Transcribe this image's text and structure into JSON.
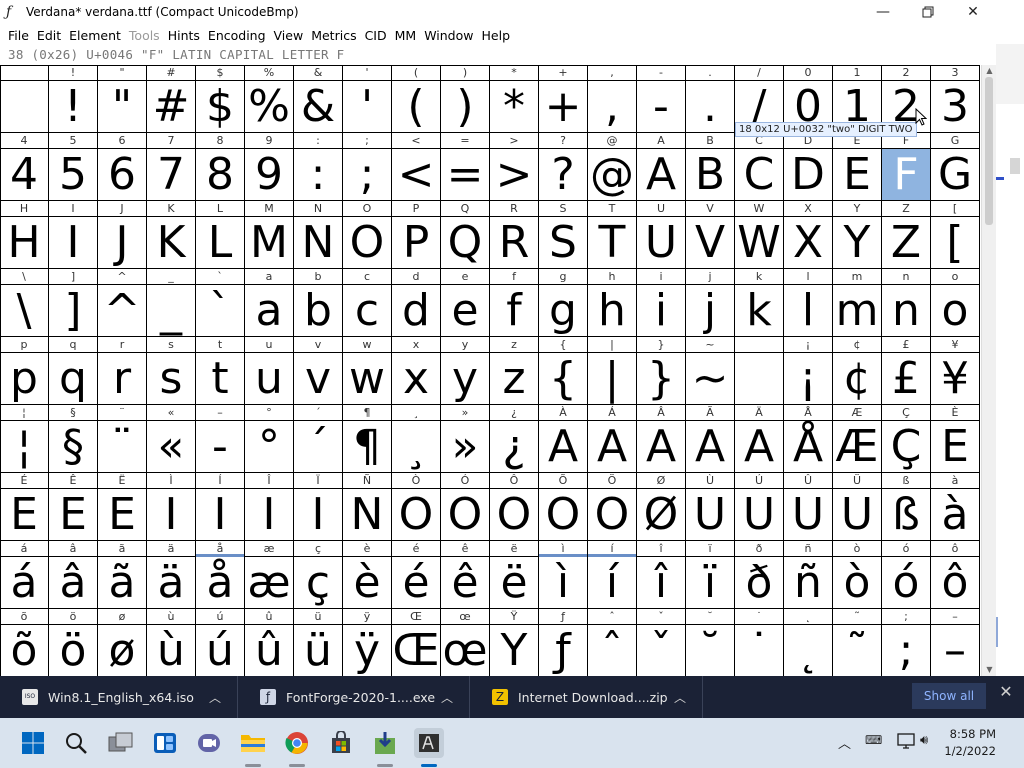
{
  "window": {
    "title": "Verdana*  verdana.ttf (Compact UnicodeBmp)",
    "minimize": "—",
    "maximize": "❐",
    "close": "✕"
  },
  "menu": [
    {
      "label": "File",
      "disabled": false
    },
    {
      "label": "Edit",
      "disabled": false
    },
    {
      "label": "Element",
      "disabled": false
    },
    {
      "label": "Tools",
      "disabled": true
    },
    {
      "label": "Hints",
      "disabled": false
    },
    {
      "label": "Encoding",
      "disabled": false
    },
    {
      "label": "View",
      "disabled": false
    },
    {
      "label": "Metrics",
      "disabled": false
    },
    {
      "label": "CID",
      "disabled": false
    },
    {
      "label": "MM",
      "disabled": false
    },
    {
      "label": "Window",
      "disabled": false
    },
    {
      "label": "Help",
      "disabled": false
    }
  ],
  "info_line": "38 (0x26) U+0046 \"F\" LATIN CAPITAL LETTER F",
  "tooltip": "18 0x12 U+0032 \"two\" DIGIT TWO",
  "selected_cell": "F",
  "grid": {
    "rows": [
      {
        "labels": [
          " ",
          "!",
          "\"",
          "#",
          "$",
          "%",
          "&",
          "'",
          "(",
          ")",
          "*",
          "+",
          ",",
          "-",
          ".",
          "/",
          "0",
          "1",
          "2",
          "3"
        ],
        "glyphs": [
          " ",
          "!",
          "\"",
          "#",
          "$",
          "%",
          "&",
          "'",
          "(",
          ")",
          "*",
          "+",
          ",",
          "-",
          ".",
          "/",
          "0",
          "1",
          "2",
          "3"
        ]
      },
      {
        "labels": [
          "4",
          "5",
          "6",
          "7",
          "8",
          "9",
          ":",
          ";",
          "<",
          "=",
          ">",
          "?",
          "@",
          "A",
          "B",
          "C",
          "D",
          "E",
          "F",
          "G"
        ],
        "glyphs": [
          "4",
          "5",
          "6",
          "7",
          "8",
          "9",
          ":",
          ";",
          "<",
          "=",
          ">",
          "?",
          "@",
          "A",
          "B",
          "C",
          "D",
          "E",
          "F",
          "G"
        ]
      },
      {
        "labels": [
          "H",
          "I",
          "J",
          "K",
          "L",
          "M",
          "N",
          "O",
          "P",
          "Q",
          "R",
          "S",
          "T",
          "U",
          "V",
          "W",
          "X",
          "Y",
          "Z",
          "["
        ],
        "glyphs": [
          "H",
          "I",
          "J",
          "K",
          "L",
          "M",
          "N",
          "O",
          "P",
          "Q",
          "R",
          "S",
          "T",
          "U",
          "V",
          "W",
          "X",
          "Y",
          "Z",
          "["
        ]
      },
      {
        "labels": [
          "\\",
          "]",
          "^",
          "_",
          "`",
          "a",
          "b",
          "c",
          "d",
          "e",
          "f",
          "g",
          "h",
          "i",
          "j",
          "k",
          "l",
          "m",
          "n",
          "o"
        ],
        "glyphs": [
          "\\",
          "]",
          "^",
          "_",
          "`",
          "a",
          "b",
          "c",
          "d",
          "e",
          "f",
          "g",
          "h",
          "i",
          "j",
          "k",
          "l",
          "m",
          "n",
          "o"
        ]
      },
      {
        "labels": [
          "p",
          "q",
          "r",
          "s",
          "t",
          "u",
          "v",
          "w",
          "x",
          "y",
          "z",
          "{",
          "|",
          "}",
          "~",
          "",
          "¡",
          "¢",
          "£",
          "¥"
        ],
        "glyphs": [
          "p",
          "q",
          "r",
          "s",
          "t",
          "u",
          "v",
          "w",
          "x",
          "y",
          "z",
          "{",
          "|",
          "}",
          "~",
          "",
          "¡",
          "¢",
          "£",
          "¥"
        ]
      },
      {
        "labels": [
          "¦",
          "§",
          "¨",
          "«",
          "–",
          "°",
          "´",
          "¶",
          "¸",
          "»",
          "¿",
          "À",
          "Á",
          "Â",
          "Ã",
          "Ä",
          "Å",
          "Æ",
          "Ç",
          "È"
        ],
        "glyphs": [
          "¦",
          "§",
          "¨",
          "«",
          "-",
          "°",
          "´",
          "¶",
          "¸",
          "»",
          "¿",
          "A",
          "A",
          "A",
          "A",
          "A",
          "Å",
          "Æ",
          "Ç",
          "E"
        ]
      },
      {
        "labels": [
          "É",
          "Ê",
          "Ë",
          "Ì",
          "Í",
          "Î",
          "Ï",
          "Ñ",
          "Ò",
          "Ó",
          "Ô",
          "Õ",
          "Ö",
          "Ø",
          "Ù",
          "Ú",
          "Û",
          "Ü",
          "ß",
          "à"
        ],
        "glyphs": [
          "E",
          "E",
          "E",
          "I",
          "I",
          "I",
          "I",
          "N",
          "O",
          "O",
          "O",
          "O",
          "O",
          "Ø",
          "U",
          "U",
          "U",
          "U",
          "ß",
          "à"
        ]
      },
      {
        "labels": [
          "á",
          "â",
          "ã",
          "ä",
          "å",
          "æ",
          "ç",
          "è",
          "é",
          "ê",
          "ë",
          "ì",
          "í",
          "î",
          "ï",
          "ð",
          "ñ",
          "ò",
          "ó",
          "ô"
        ],
        "glyphs": [
          "á",
          "â",
          "ã",
          "ä",
          "å",
          "æ",
          "ç",
          "è",
          "é",
          "ê",
          "ë",
          "ì",
          "í",
          "î",
          "ï",
          "ð",
          "ñ",
          "ò",
          "ó",
          "ô"
        ]
      },
      {
        "labels": [
          "õ",
          "ö",
          "ø",
          "ù",
          "ú",
          "û",
          "ü",
          "ÿ",
          "Œ",
          "œ",
          "Ÿ",
          "ƒ",
          "ˆ",
          "ˇ",
          "˘",
          "˙",
          "˛",
          "˜",
          ";",
          "–"
        ],
        "glyphs": [
          "õ",
          "ö",
          "ø",
          "ù",
          "ú",
          "û",
          "ü",
          "ÿ",
          "Œ",
          "œ",
          "Y",
          "ƒ",
          "ˆ",
          "ˇ",
          "˘",
          "˙",
          "˛",
          "˜",
          ";",
          "–"
        ]
      }
    ],
    "marked_labels": [
      [
        7,
        4
      ],
      [
        7,
        11
      ],
      [
        7,
        12
      ]
    ]
  },
  "notifications": [
    {
      "icon": "iso-file-icon",
      "icon_glyph": "ISO",
      "icon_color": "#e8e8e8",
      "name": "Win8.1_English_x64.iso"
    },
    {
      "icon": "fontforge-icon",
      "icon_glyph": "ƒ",
      "icon_color": "#cfd6e6",
      "name": "FontForge-2020-1....exe"
    },
    {
      "icon": "zip-file-icon",
      "icon_glyph": "Z",
      "icon_color": "#f2c200",
      "name": "Internet Download....zip"
    }
  ],
  "show_all_label": "Show all",
  "notif_close": "✕",
  "clock": {
    "time": "8:58 PM",
    "date": "1/2/2022"
  },
  "colors": {
    "selection": "#8fb4e0",
    "taskbar": "#d9e3ee",
    "notif_bar": "#1b2236",
    "accent": "#0067c0"
  }
}
